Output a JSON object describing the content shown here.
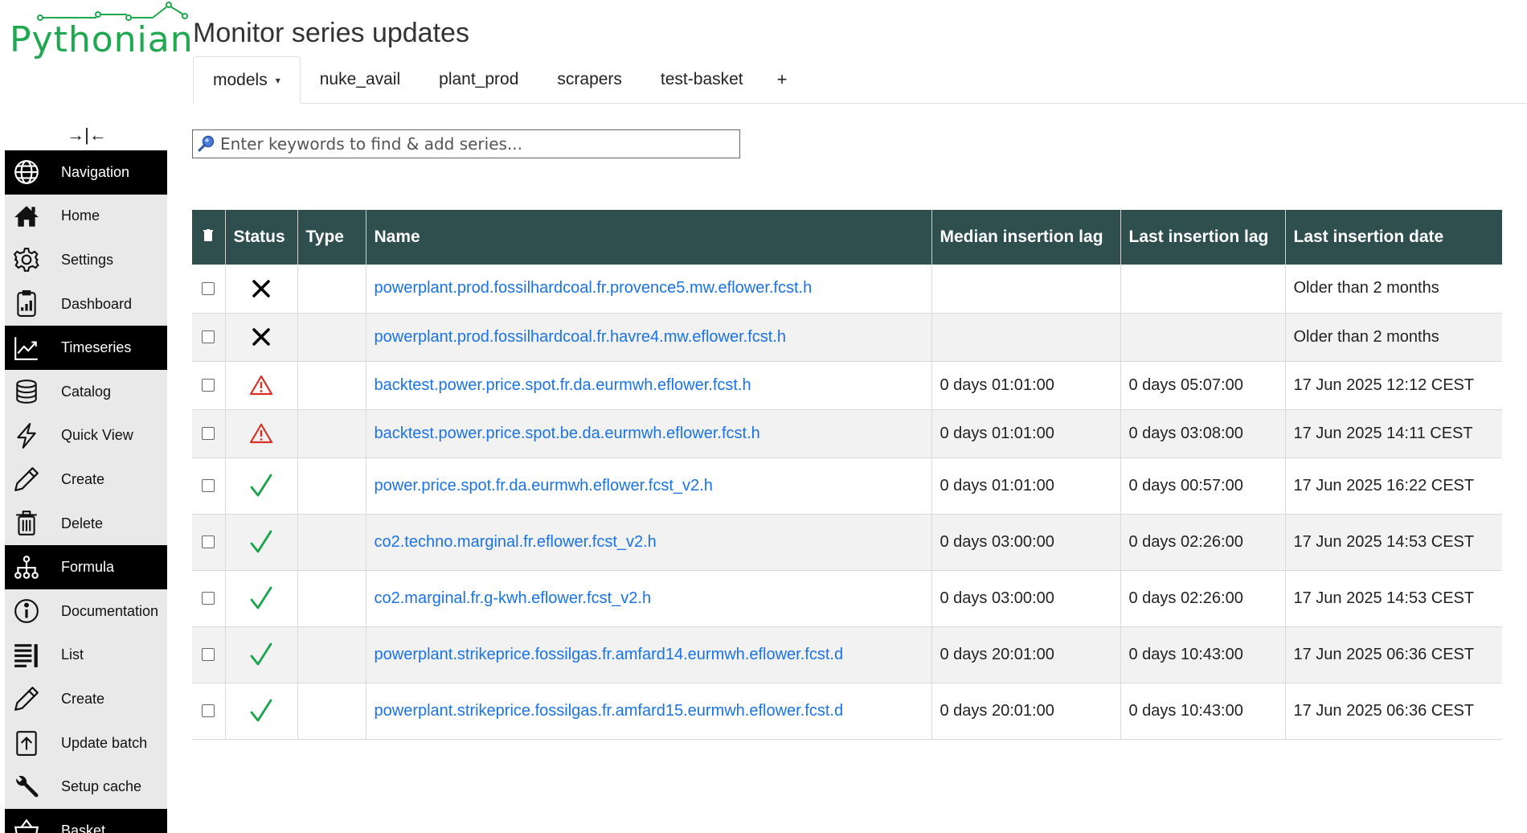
{
  "app": {
    "logo_text": "Pythonian"
  },
  "page": {
    "title": "Monitor series updates"
  },
  "tabs": [
    {
      "label": "models",
      "active": true
    },
    {
      "label": "nuke_avail",
      "active": false
    },
    {
      "label": "plant_prod",
      "active": false
    },
    {
      "label": "scrapers",
      "active": false
    },
    {
      "label": "test-basket",
      "active": false
    }
  ],
  "tabs_add_label": "+",
  "search": {
    "placeholder": "Enter keywords to find & add series..."
  },
  "sidebar": {
    "collapse_label": "→|←",
    "items": [
      {
        "label": "Navigation",
        "icon": "globe-icon",
        "section": true
      },
      {
        "label": "Home",
        "icon": "home-icon",
        "section": false
      },
      {
        "label": "Settings",
        "icon": "gear-icon",
        "section": false
      },
      {
        "label": "Dashboard",
        "icon": "dashboard-icon",
        "section": false
      },
      {
        "label": "Timeseries",
        "icon": "chart-line-icon",
        "section": true
      },
      {
        "label": "Catalog",
        "icon": "database-icon",
        "section": false
      },
      {
        "label": "Quick View",
        "icon": "lightning-icon",
        "section": false
      },
      {
        "label": "Create",
        "icon": "pencil-icon",
        "section": false
      },
      {
        "label": "Delete",
        "icon": "trash-icon",
        "section": false
      },
      {
        "label": "Formula",
        "icon": "hierarchy-icon",
        "section": true
      },
      {
        "label": "Documentation",
        "icon": "info-icon",
        "section": false
      },
      {
        "label": "List",
        "icon": "list-icon",
        "section": false
      },
      {
        "label": "Create",
        "icon": "pencil-icon",
        "section": false
      },
      {
        "label": "Update batch",
        "icon": "upload-icon",
        "section": false
      },
      {
        "label": "Setup cache",
        "icon": "wrench-icon",
        "section": false
      },
      {
        "label": "Basket",
        "icon": "basket-icon",
        "section": true
      }
    ]
  },
  "table": {
    "headers": {
      "select": "trash-icon",
      "status": "Status",
      "type": "Type",
      "name": "Name",
      "median_lag": "Median insertion lag",
      "last_lag": "Last insertion lag",
      "last_date": "Last insertion date"
    },
    "rows": [
      {
        "status": "error",
        "type": "",
        "name": "powerplant.prod.fossilhardcoal.fr.provence5.mw.eflower.fcst.h",
        "median_lag": "",
        "last_lag": "",
        "last_date": "Older than 2 months"
      },
      {
        "status": "error",
        "type": "",
        "name": "powerplant.prod.fossilhardcoal.fr.havre4.mw.eflower.fcst.h",
        "median_lag": "",
        "last_lag": "",
        "last_date": "Older than 2 months"
      },
      {
        "status": "warning",
        "type": "",
        "name": "backtest.power.price.spot.fr.da.eurmwh.eflower.fcst.h",
        "median_lag": "0 days 01:01:00",
        "last_lag": "0 days 05:07:00",
        "last_date": "17 Jun 2025 12:12 CEST"
      },
      {
        "status": "warning",
        "type": "",
        "name": "backtest.power.price.spot.be.da.eurmwh.eflower.fcst.h",
        "median_lag": "0 days 01:01:00",
        "last_lag": "0 days 03:08:00",
        "last_date": "17 Jun 2025 14:11 CEST"
      },
      {
        "status": "ok",
        "type": "",
        "name": "power.price.spot.fr.da.eurmwh.eflower.fcst_v2.h",
        "median_lag": "0 days 01:01:00",
        "last_lag": "0 days 00:57:00",
        "last_date": "17 Jun 2025 16:22 CEST"
      },
      {
        "status": "ok",
        "type": "",
        "name": "co2.techno.marginal.fr.eflower.fcst_v2.h",
        "median_lag": "0 days 03:00:00",
        "last_lag": "0 days 02:26:00",
        "last_date": "17 Jun 2025 14:53 CEST"
      },
      {
        "status": "ok",
        "type": "",
        "name": "co2.marginal.fr.g-kwh.eflower.fcst_v2.h",
        "median_lag": "0 days 03:00:00",
        "last_lag": "0 days 02:26:00",
        "last_date": "17 Jun 2025 14:53 CEST"
      },
      {
        "status": "ok",
        "type": "",
        "name": "powerplant.strikeprice.fossilgas.fr.amfard14.eurmwh.eflower.fcst.d",
        "median_lag": "0 days 20:01:00",
        "last_lag": "0 days 10:43:00",
        "last_date": "17 Jun 2025 06:36 CEST"
      },
      {
        "status": "ok",
        "type": "",
        "name": "powerplant.strikeprice.fossilgas.fr.amfard15.eurmwh.eflower.fcst.d",
        "median_lag": "0 days 20:01:00",
        "last_lag": "0 days 10:43:00",
        "last_date": "17 Jun 2025 06:36 CEST"
      }
    ]
  },
  "colors": {
    "brand": "#1fa84f",
    "table_header": "#2f4f4f",
    "link": "#1a73e8",
    "status_ok": "#1aa34a",
    "status_warning": "#d93025",
    "status_error": "#000000"
  }
}
